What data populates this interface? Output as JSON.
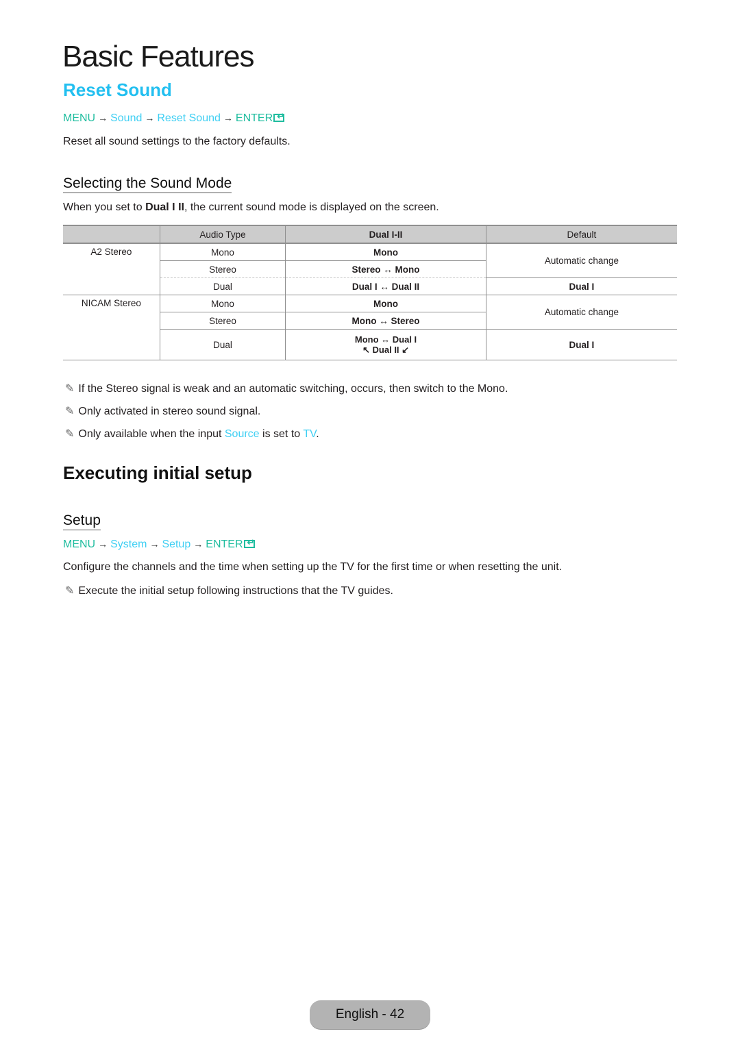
{
  "page_title": "Basic Features",
  "reset_sound": {
    "title": "Reset Sound",
    "path": {
      "menu": "MENU",
      "arrow": "→",
      "items": [
        "Sound",
        "Reset Sound"
      ],
      "enter": "ENTER",
      "enter_icon": "enter-return-icon"
    },
    "description": "Reset all sound settings to the factory defaults."
  },
  "sound_mode": {
    "title": "Selecting the Sound Mode",
    "intro_prefix": "When you set to ",
    "intro_bold": "Dual I II",
    "intro_suffix": ", the current sound mode is displayed on the screen.",
    "table": {
      "headers": [
        "",
        "Audio Type",
        "Dual I-II",
        "Default"
      ],
      "groups": [
        {
          "name": "A2 Stereo",
          "rows": [
            {
              "audio_type": "Mono",
              "dual": "Mono"
            },
            {
              "audio_type": "Stereo",
              "dual": "Stereo ↔ Mono"
            },
            {
              "audio_type": "Dual",
              "dual": "Dual I ↔ Dual II",
              "default": "Dual I"
            }
          ],
          "default_shared": "Automatic change"
        },
        {
          "name": "NICAM Stereo",
          "rows": [
            {
              "audio_type": "Mono",
              "dual": "Mono"
            },
            {
              "audio_type": "Stereo",
              "dual": "Mono ↔ Stereo"
            },
            {
              "audio_type": "Dual",
              "dual": "Mono ↔ Dual I",
              "dual_line2": "↖ Dual II ↙",
              "default": "Dual I"
            }
          ],
          "default_shared": "Automatic change"
        }
      ]
    },
    "notes": [
      "If the Stereo signal is weak and an automatic switching, occurs, then switch to the Mono.",
      "Only activated in stereo sound signal."
    ],
    "note_source": {
      "prefix": "Only available when the input ",
      "source": "Source",
      "middle": " is set to ",
      "tv": "TV",
      "suffix": "."
    },
    "note_icon": "✎"
  },
  "initial_setup": {
    "title": "Executing initial setup",
    "setup_title": "Setup",
    "path": {
      "menu": "MENU",
      "arrow": "→",
      "items": [
        "System",
        "Setup"
      ],
      "enter": "ENTER"
    },
    "description": "Configure the channels and the time when setting up the TV for the first time or when resetting the unit.",
    "note": "Execute the initial setup following instructions that the TV guides."
  },
  "footer": {
    "page_label": "English - 42"
  },
  "colors": {
    "heading_cyan": "#22bff0",
    "menu_green": "#1fbd9f",
    "link_cyan": "#3fcff3",
    "table_header_bg": "#cccccc",
    "footer_pill_bg": "#b3b3b3"
  }
}
